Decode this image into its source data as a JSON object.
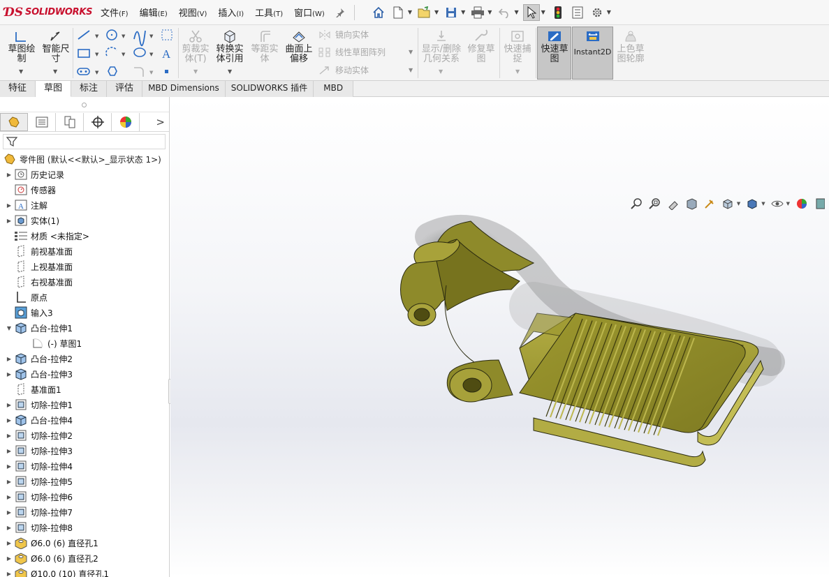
{
  "app": {
    "brand_ds": "ƊS",
    "brand_name": "SOLIDWORKS"
  },
  "menu": [
    {
      "label": "文件",
      "key": "(F)"
    },
    {
      "label": "编辑",
      "key": "(E)"
    },
    {
      "label": "视图",
      "key": "(V)"
    },
    {
      "label": "插入",
      "key": "(I)"
    },
    {
      "label": "工具",
      "key": "(T)"
    },
    {
      "label": "窗口",
      "key": "(W)"
    }
  ],
  "ribbon": {
    "sketch_draw": [
      "草图绘",
      "制"
    ],
    "smart_dim": [
      "智能尺",
      "寸"
    ],
    "trim": [
      "剪裁实",
      "体(T)"
    ],
    "convert": [
      "转换实",
      "体引用"
    ],
    "offset_dist": [
      "等距实",
      "体"
    ],
    "surface_offset": [
      "曲面上",
      "偏移"
    ],
    "mirror": "镜向实体",
    "linear_pattern": "线性草图阵列",
    "move": "移动实体",
    "relations": [
      "显示/删除",
      "几何关系"
    ],
    "repair": [
      "修复草",
      "图"
    ],
    "quick_snap": [
      "快速捕",
      "捉"
    ],
    "rapid_sketch": [
      "快速草",
      "图"
    ],
    "instant2d": "Instant2D",
    "shaded_contours": [
      "上色草",
      "图轮廓"
    ]
  },
  "tabs": [
    "特征",
    "草图",
    "标注",
    "评估",
    "MBD Dimensions",
    "SOLIDWORKS 插件",
    "MBD"
  ],
  "active_tab": "草图",
  "feature_tree": {
    "root": "零件图 (默认<<默认>_显示状态 1>)",
    "items": [
      {
        "label": "历史记录",
        "expand": "▶",
        "icon": "history-icon"
      },
      {
        "label": "传感器",
        "expand": "",
        "icon": "sensor-icon"
      },
      {
        "label": "注解",
        "expand": "▶",
        "icon": "annotation-icon"
      },
      {
        "label": "实体(1)",
        "expand": "▶",
        "icon": "solid-bodies-icon"
      },
      {
        "label": "材质 <未指定>",
        "expand": "",
        "icon": "material-icon"
      },
      {
        "label": "前视基准面",
        "expand": "",
        "icon": "plane-icon"
      },
      {
        "label": "上视基准面",
        "expand": "",
        "icon": "plane-icon"
      },
      {
        "label": "右视基准面",
        "expand": "",
        "icon": "plane-icon"
      },
      {
        "label": "原点",
        "expand": "",
        "icon": "origin-icon"
      },
      {
        "label": "输入3",
        "expand": "",
        "icon": "imported-body-icon"
      },
      {
        "label": "凸台-拉伸1",
        "expand": "▼",
        "icon": "boss-extrude-icon"
      },
      {
        "label": "(-) 草图1",
        "expand": "",
        "icon": "sketch-icon",
        "child": true
      },
      {
        "label": "凸台-拉伸2",
        "expand": "▶",
        "icon": "boss-extrude-icon"
      },
      {
        "label": "凸台-拉伸3",
        "expand": "▶",
        "icon": "boss-extrude-icon"
      },
      {
        "label": "基准面1",
        "expand": "",
        "icon": "plane-icon"
      },
      {
        "label": "切除-拉伸1",
        "expand": "▶",
        "icon": "cut-extrude-icon"
      },
      {
        "label": "凸台-拉伸4",
        "expand": "▶",
        "icon": "boss-extrude-icon"
      },
      {
        "label": "切除-拉伸2",
        "expand": "▶",
        "icon": "cut-extrude-icon"
      },
      {
        "label": "切除-拉伸3",
        "expand": "▶",
        "icon": "cut-extrude-icon"
      },
      {
        "label": "切除-拉伸4",
        "expand": "▶",
        "icon": "cut-extrude-icon"
      },
      {
        "label": "切除-拉伸5",
        "expand": "▶",
        "icon": "cut-extrude-icon"
      },
      {
        "label": "切除-拉伸6",
        "expand": "▶",
        "icon": "cut-extrude-icon"
      },
      {
        "label": "切除-拉伸7",
        "expand": "▶",
        "icon": "cut-extrude-icon"
      },
      {
        "label": "切除-拉伸8",
        "expand": "▶",
        "icon": "cut-extrude-icon"
      },
      {
        "label": "Ø6.0 (6) 直径孔1",
        "expand": "▶",
        "icon": "hole-wizard-icon"
      },
      {
        "label": "Ø6.0 (6) 直径孔2",
        "expand": "▶",
        "icon": "hole-wizard-icon"
      },
      {
        "label": "Ø10.0 (10) 直径孔1",
        "expand": "▶",
        "icon": "hole-wizard-icon"
      }
    ]
  },
  "colors": {
    "brand": "#c8102e",
    "part_body": "#8f8b2c",
    "part_highlight": "#b4ae44",
    "part_shadow": "#5e5b18"
  }
}
